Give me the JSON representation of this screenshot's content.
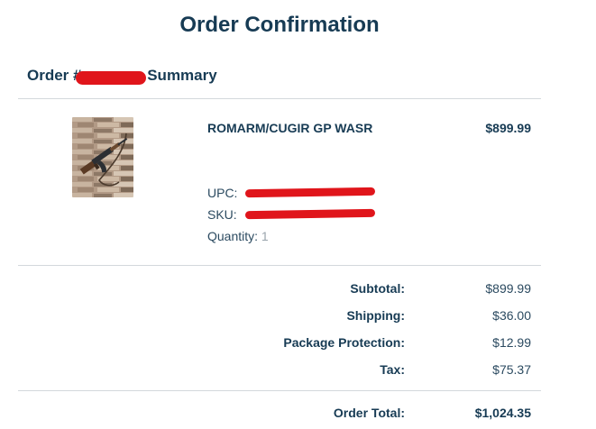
{
  "page_title": "Order Confirmation",
  "summary": {
    "prefix": "Order #",
    "suffix": "Summary"
  },
  "product": {
    "image_icon": "rifle-product-photo",
    "name": "ROMARM/CUGIR GP WASR",
    "price": "$899.99",
    "upc_label": "UPC:",
    "sku_label": "SKU:",
    "quantity_label": "Quantity:",
    "quantity_value": "1"
  },
  "totals": {
    "subtotal_label": "Subtotal:",
    "subtotal_value": "$899.99",
    "shipping_label": "Shipping:",
    "shipping_value": "$36.00",
    "protection_label": "Package Protection:",
    "protection_value": "$12.99",
    "tax_label": "Tax:",
    "tax_value": "$75.37",
    "order_total_label": "Order Total:",
    "order_total_value": "$1,024.35"
  },
  "colors": {
    "heading": "#173b54",
    "divider": "#d3d8dc",
    "redaction": "#e0151b",
    "muted_value": "#9aa5ad"
  }
}
